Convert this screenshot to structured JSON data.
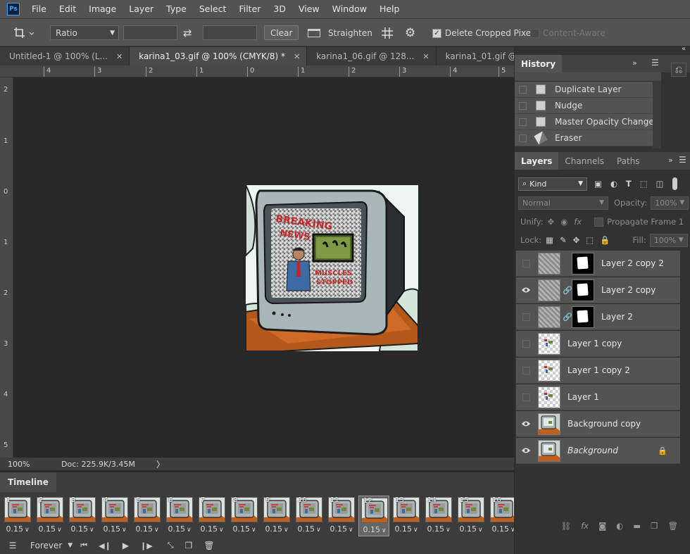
{
  "app": {
    "logo": "Ps"
  },
  "menu": [
    "File",
    "Edit",
    "Image",
    "Layer",
    "Type",
    "Select",
    "Filter",
    "3D",
    "View",
    "Window",
    "Help"
  ],
  "options": {
    "ratio_label": "Ratio",
    "clear_label": "Clear",
    "straighten_label": "Straighten",
    "delete_cropped_label": "Delete Cropped Pixels",
    "delete_cropped_checked": true,
    "content_aware_label": "Content-Aware",
    "content_aware_checked": false
  },
  "tabs": [
    {
      "label": "Untitled-1 @ 100% (L...",
      "active": false
    },
    {
      "label": "karina1_03.gif @ 100% (CMYK/8) *",
      "active": true
    },
    {
      "label": "karina1_06.gif @ 128...",
      "active": false
    },
    {
      "label": "karina1_01.gif @ 100...",
      "active": false
    }
  ],
  "rulers": {
    "h_labels": [
      "4",
      "3",
      "2",
      "1",
      "0",
      "1",
      "2",
      "3",
      "4",
      "5"
    ],
    "v_labels": [
      "2",
      "1",
      "0",
      "1",
      "2",
      "3",
      "4",
      "5"
    ]
  },
  "status": {
    "zoom": "100%",
    "doc": "Doc: 225.9K/3.45M"
  },
  "artwork": {
    "headline_1": "BREAKING",
    "headline_2": "NEWS",
    "caption_1": "MUSCLES",
    "caption_2": "STOPPED"
  },
  "timeline": {
    "title": "Timeline",
    "loop": "Forever",
    "frames": [
      {
        "n": "1",
        "delay": "0.15"
      },
      {
        "n": "2",
        "delay": "0.15"
      },
      {
        "n": "3",
        "delay": "0.15"
      },
      {
        "n": "4",
        "delay": "0.15"
      },
      {
        "n": "5",
        "delay": "0.15"
      },
      {
        "n": "6",
        "delay": "0.15"
      },
      {
        "n": "7",
        "delay": "0.15"
      },
      {
        "n": "8",
        "delay": "0.15"
      },
      {
        "n": "9",
        "delay": "0.15"
      },
      {
        "n": "10",
        "delay": "0.15"
      },
      {
        "n": "11",
        "delay": "0.15"
      },
      {
        "n": "12",
        "delay": "0.15"
      },
      {
        "n": "13",
        "delay": "0.15"
      },
      {
        "n": "14",
        "delay": "0.15"
      },
      {
        "n": "15",
        "delay": "0.15"
      },
      {
        "n": "16",
        "delay": "0.15"
      }
    ],
    "selected_frame": "12"
  },
  "history": {
    "title": "History",
    "items": [
      "Duplicate Layer",
      "Nudge",
      "Master Opacity Change",
      "Eraser"
    ]
  },
  "layers_panel": {
    "tabs": [
      "Layers",
      "Channels",
      "Paths"
    ],
    "kind": "Kind",
    "blend": "Normal",
    "opacity_label": "Opacity:",
    "opacity_value": "100%",
    "unify_label": "Unify:",
    "propagate_label": "Propagate Frame 1",
    "lock_label": "Lock:",
    "fill_label": "Fill:",
    "fill_value": "100%",
    "layers": [
      {
        "name": "Layer 2 copy 2",
        "visible": false,
        "thumb": "noise",
        "mask": true
      },
      {
        "name": "Layer 2 copy",
        "visible": true,
        "thumb": "noise",
        "mask": true
      },
      {
        "name": "Layer 2",
        "visible": false,
        "thumb": "noise",
        "mask": true
      },
      {
        "name": "Layer 1 copy",
        "visible": false,
        "thumb": "trans",
        "mask": false
      },
      {
        "name": "Layer 1 copy 2",
        "visible": false,
        "thumb": "trans",
        "mask": false
      },
      {
        "name": "Layer 1",
        "visible": false,
        "thumb": "trans",
        "mask": false
      },
      {
        "name": "Background copy",
        "visible": true,
        "thumb": "art",
        "mask": false
      },
      {
        "name": "Background",
        "visible": true,
        "thumb": "art",
        "mask": false,
        "locked": true
      }
    ]
  }
}
